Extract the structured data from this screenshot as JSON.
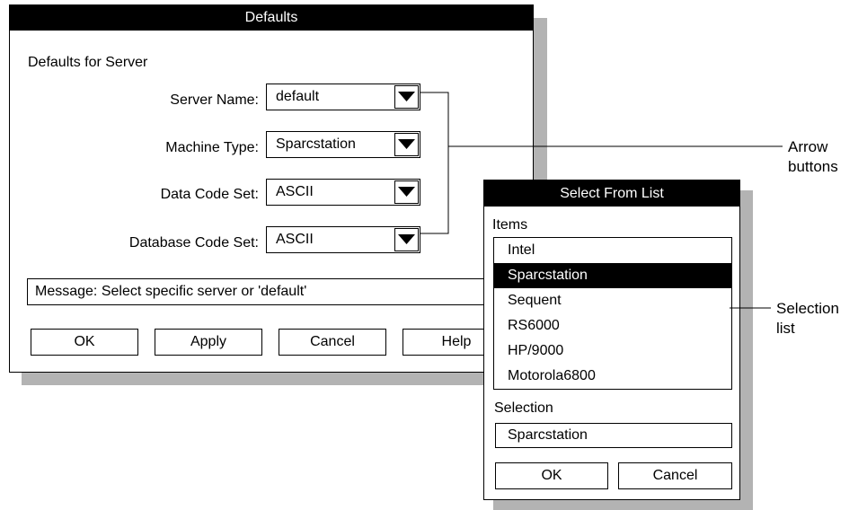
{
  "defaults_window": {
    "title": "Defaults",
    "group_label": "Defaults for Server",
    "fields": [
      {
        "label": "Server Name:",
        "value": "default"
      },
      {
        "label": "Machine Type:",
        "value": "Sparcstation"
      },
      {
        "label": "Data Code Set:",
        "value": "ASCII"
      },
      {
        "label": "Database Code Set:",
        "value": "ASCII"
      }
    ],
    "message": "Message: Select specific server or 'default'",
    "buttons": {
      "ok": "OK",
      "apply": "Apply",
      "cancel": "Cancel",
      "help": "Help"
    }
  },
  "select_window": {
    "title": "Select From List",
    "items_label": "Items",
    "items": [
      "Intel",
      "Sparcstation",
      "Sequent",
      "RS6000",
      "HP/9000",
      "Motorola6800"
    ],
    "selected_item": "Sparcstation",
    "selection_label": "Selection",
    "selection_value": "Sparcstation",
    "buttons": {
      "ok": "OK",
      "cancel": "Cancel"
    }
  },
  "callouts": {
    "arrow_buttons": {
      "line1": "Arrow",
      "line2": "buttons"
    },
    "selection_list": {
      "line1": "Selection",
      "line2": "list"
    }
  },
  "icons": {
    "arrow_button": "down-triangle-icon"
  },
  "colors": {
    "shadow": "#b3b3b3",
    "titlebar": "#000000",
    "selected_row": "#000000"
  }
}
